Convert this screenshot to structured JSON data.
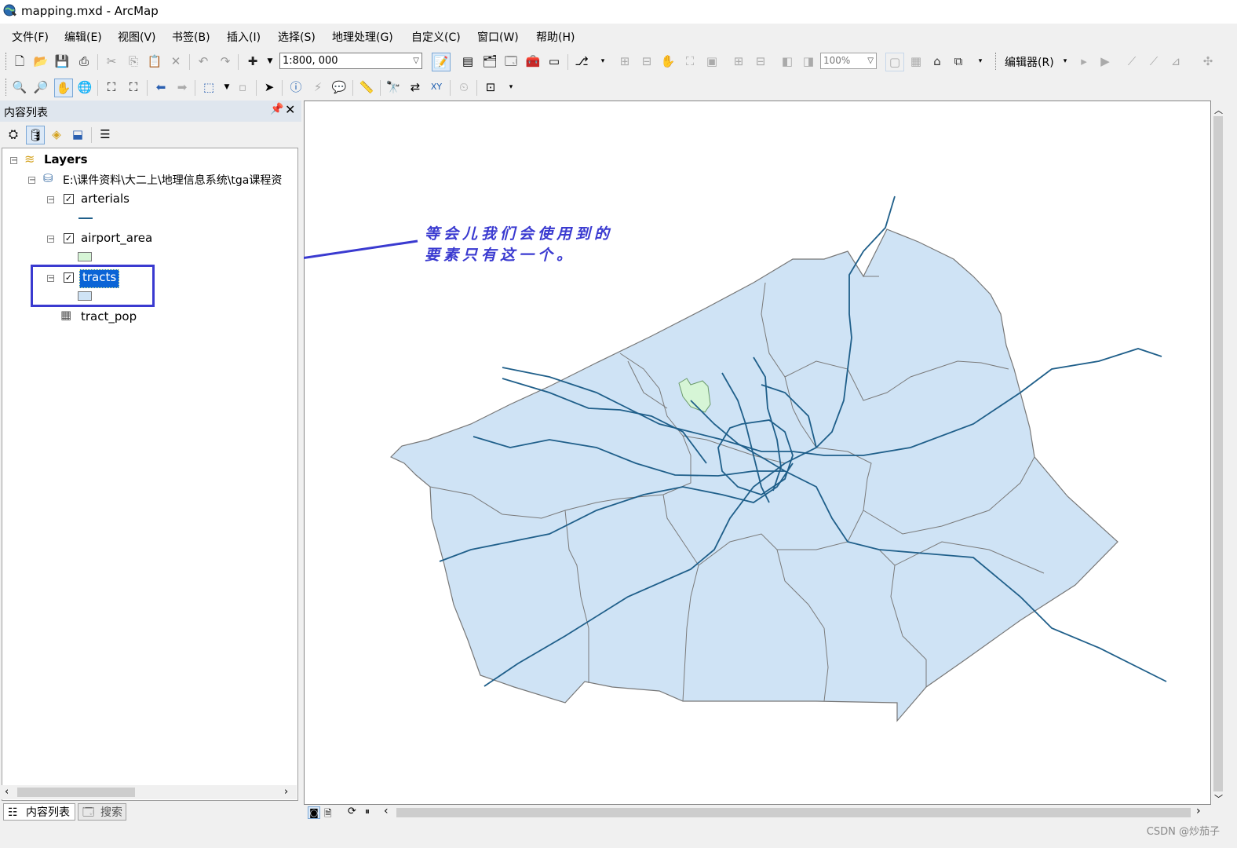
{
  "window": {
    "title": "mapping.mxd - ArcMap"
  },
  "menu": [
    "文件(F)",
    "编辑(E)",
    "视图(V)",
    "书签(B)",
    "插入(I)",
    "选择(S)",
    "地理处理(G)",
    "自定义(C)",
    "窗口(W)",
    "帮助(H)"
  ],
  "toolbar": {
    "scale_value": "1:800, 000",
    "zoom_value": "100%",
    "editor_label": "编辑器(R)"
  },
  "toc": {
    "title": "内容列表",
    "root": "Layers",
    "source": "E:\\课件资料\\大二上\\地理信息系统\\tga课程资",
    "layers": [
      {
        "name": "arterials",
        "checked": true,
        "symbol": "line",
        "color": "#1f5f8a"
      },
      {
        "name": "airport_area",
        "checked": true,
        "symbol": "polygon",
        "color": "#d6f5d6"
      },
      {
        "name": "tracts",
        "checked": true,
        "symbol": "polygon",
        "color": "#cfe3f5",
        "selected": true
      }
    ],
    "table": "tract_pop",
    "tabs": [
      "内容列表",
      "搜索"
    ]
  },
  "annotation": {
    "line1": "等会儿我们会使用到的",
    "line2": "要素只有这一个。",
    "color": "#3a3ad0"
  },
  "map": {
    "tract_fill": "#cfe3f5",
    "airport_fill": "#d6f5d6",
    "road_color": "#1f5f8a"
  },
  "watermark": "CSDN @炒茄子"
}
